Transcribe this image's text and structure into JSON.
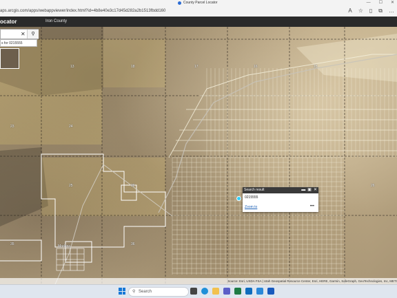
{
  "browser": {
    "tab_title": "County Parcel Locator",
    "address": "aps.arcgis.com/apps/webappviewer/index.html?id=4b8e40e3c17d45d282a2b1513fbdd160",
    "icons": [
      "read-aloud-icon",
      "favorites-icon",
      "split-screen-icon",
      "collections-icon",
      "more-icon"
    ]
  },
  "app": {
    "title": "ocator",
    "subtitle": "Iron County"
  },
  "search": {
    "value": "",
    "clear_glyph": "✕",
    "suggestion": "s for 0215555"
  },
  "map": {
    "section_labels": [
      {
        "id": "s13",
        "text": "13"
      },
      {
        "id": "s18",
        "text": "18"
      },
      {
        "id": "s17",
        "text": "17"
      },
      {
        "id": "s16",
        "text": "16"
      },
      {
        "id": "s15",
        "text": "15"
      },
      {
        "id": "s23",
        "text": "23"
      },
      {
        "id": "s24",
        "text": "24"
      },
      {
        "id": "s25",
        "text": "25"
      },
      {
        "id": "s26",
        "text": "26"
      },
      {
        "id": "s26b",
        "text": "26"
      },
      {
        "id": "s35",
        "text": "35"
      },
      {
        "id": "s36",
        "text": "36"
      }
    ],
    "town_label": "Modena"
  },
  "popup": {
    "header": "Search result",
    "value": "0215555",
    "zoom_label": "Zoom to",
    "more_label": "•••"
  },
  "attribution": "Source: Esri, USDA FSA | Utah Geospatial Resource Center, Esri, HERE, Garmin, SafeGraph, GeoTechnologies, Inc, METI",
  "taskbar": {
    "search_placeholder": "Search"
  }
}
